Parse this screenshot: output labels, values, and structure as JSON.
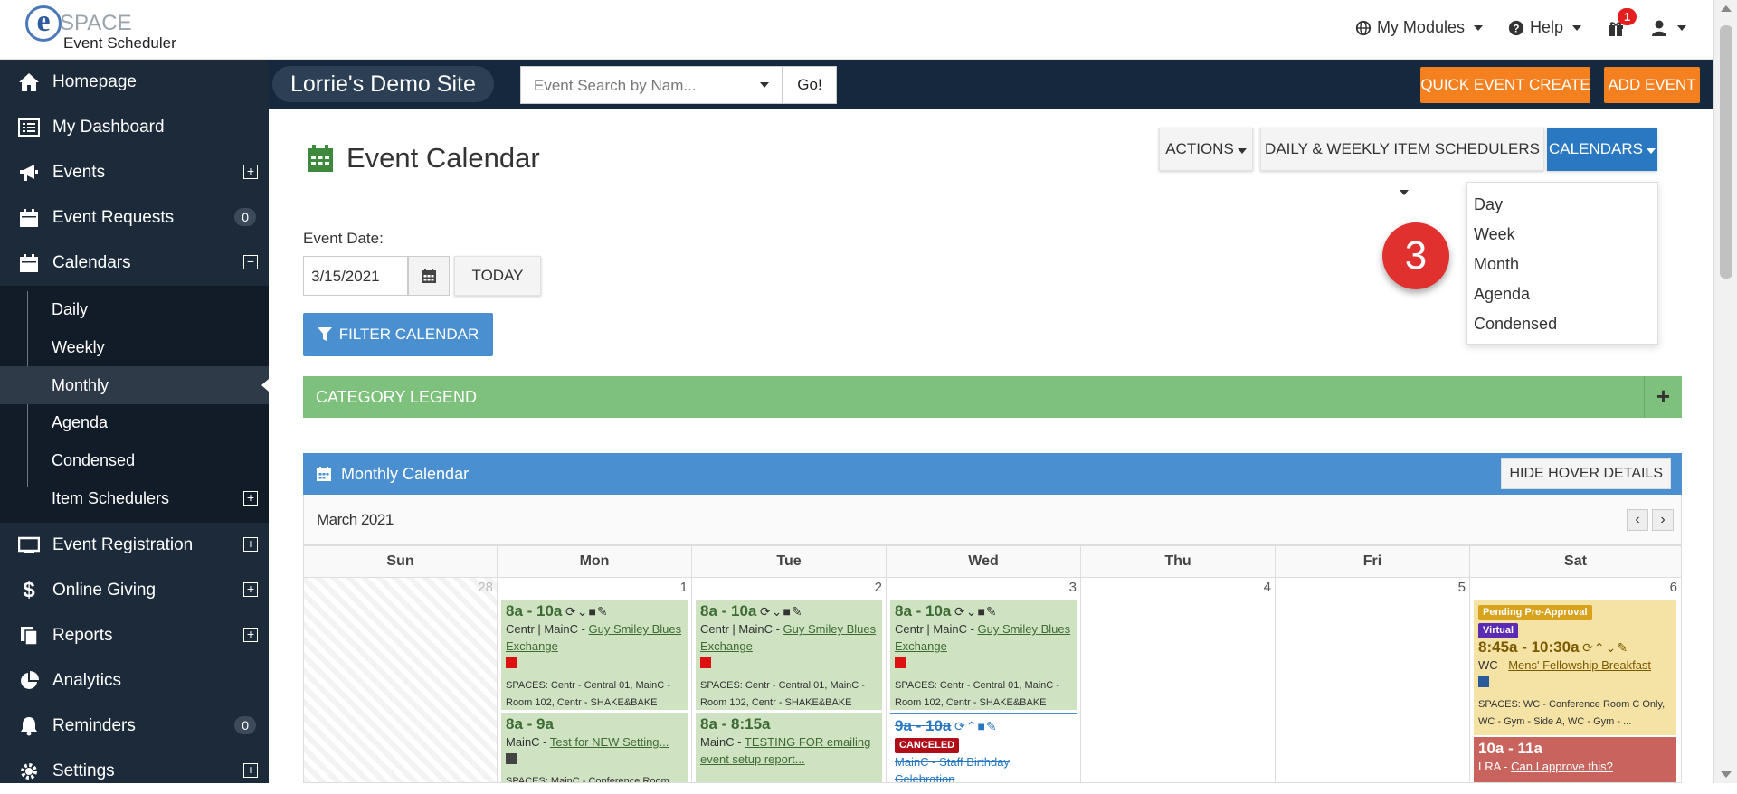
{
  "app": {
    "logo_e": "e",
    "logo_space": "SPACE",
    "logo_sub": "Event Scheduler"
  },
  "topnav": {
    "modules": "My Modules",
    "help": "Help",
    "gift_count": "1"
  },
  "sidebar": {
    "items": [
      {
        "label": "Homepage",
        "icon": "home-icon"
      },
      {
        "label": "My Dashboard",
        "icon": "list-icon"
      },
      {
        "label": "Events",
        "icon": "bullhorn-icon",
        "expand": "+"
      },
      {
        "label": "Event Requests",
        "icon": "calendar-icon",
        "count": "0"
      },
      {
        "label": "Calendars",
        "icon": "calendar-icon",
        "expand": "−"
      }
    ],
    "sub": [
      "Daily",
      "Weekly",
      "Monthly",
      "Agenda",
      "Condensed",
      "Item Schedulers"
    ],
    "sub_expand": "+",
    "items2": [
      {
        "label": "Event Registration",
        "icon": "desktop-icon",
        "expand": "+"
      },
      {
        "label": "Online Giving",
        "icon": "dollar-icon",
        "expand": "+"
      },
      {
        "label": "Reports",
        "icon": "copy-icon",
        "expand": "+"
      },
      {
        "label": "Analytics",
        "icon": "pie-chart-icon"
      },
      {
        "label": "Reminders",
        "icon": "bell-icon",
        "count": "0"
      },
      {
        "label": "Settings",
        "icon": "gear-icon",
        "expand": "+"
      }
    ]
  },
  "subnav": {
    "site": "Lorrie's Demo Site",
    "search_placeholder": "Event Search by Nam...",
    "go": "Go!",
    "quick_create": "QUICK EVENT CREATE",
    "add_event": "ADD EVENT"
  },
  "main": {
    "title": "Event Calendar",
    "actions": "ACTIONS",
    "schedulers": "DAILY & WEEKLY ITEM SCHEDULERS",
    "calendars": "CALENDARS",
    "dropdown": [
      "Day",
      "Week",
      "Month",
      "Agenda",
      "Condensed"
    ],
    "step": "3",
    "date_label": "Event Date:",
    "date_value": "3/15/2021",
    "today": "TODAY",
    "filter": "FILTER CALENDAR",
    "legend": "CATEGORY LEGEND",
    "legend_plus": "+",
    "monthly": "Monthly Calendar",
    "hide_hover": "HIDE HOVER DETAILS",
    "month_label": "March 2021",
    "prev": "‹",
    "next": "›"
  },
  "calendar": {
    "dow": [
      "Sun",
      "Mon",
      "Tue",
      "Wed",
      "Thu",
      "Fri",
      "Sat"
    ],
    "days": [
      "28",
      "1",
      "2",
      "3",
      "4",
      "5",
      "6"
    ],
    "events": {
      "blues_time": "8a - 10a",
      "blues_loc": "Centr | MainC - ",
      "blues_title": "Guy Smiley Blues Exchange",
      "blues_spaces": "SPACES: Centr - Central 01, MainC - Room 102, Centr - SHAKE&BAKE",
      "mon2_time": "8a - 9a",
      "mon2_loc": "MainC - ",
      "mon2_title": "Test for NEW Setting...",
      "mon2_spaces": "SPACES: MainC - Conference Room",
      "tue2_time": "8a - 8:15a",
      "tue2_loc": "MainC - ",
      "tue2_title": "TESTING FOR emailing event setup report...",
      "wed2_time": "9a - 10a",
      "wed2_tag": "CANCELED",
      "wed2_title": "MainC - Staff Birthday Celebration",
      "sat_tag1": "Pending Pre-Approval",
      "sat_tag2": "Virtual",
      "sat_time": "8:45a - 10:30a",
      "sat_loc": "WC - ",
      "sat_title": "Mens' Fellowship Breakfast",
      "sat_spaces": "SPACES: WC - Conference Room C Only, WC - Gym - Side A, WC - Gym - ...",
      "sat2_time": "10a - 11a",
      "sat2_loc": "LRA - ",
      "sat2_title": "Can I approve this?"
    }
  },
  "colors": {
    "sidebar": "#1c2a3a",
    "subnav": "#16283e",
    "orange": "#f5801f",
    "blue": "#4a8fd0",
    "green": "#7ec17d"
  }
}
